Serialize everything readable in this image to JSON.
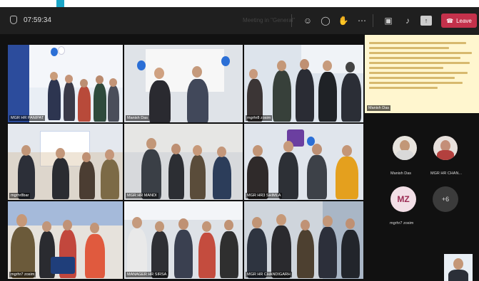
{
  "topbar": {
    "timer": "07:59:34",
    "meeting_title": "Meeting in \"General\"",
    "leave_label": "Leave",
    "icons": [
      "people-icon",
      "chat-icon",
      "reactions-icon",
      "more-icon",
      "camera-icon",
      "mic-icon",
      "share-icon"
    ]
  },
  "tiles": [
    {
      "name": "MGR HR PANIPAT"
    },
    {
      "name": "Manish Das"
    },
    {
      "name": "mgrhr8 zosim"
    },
    {
      "name": "mgrhr8bar"
    },
    {
      "name": "MGR HR MANDI"
    },
    {
      "name": "MGR HR3 SHIMLA"
    },
    {
      "name": "mgrhr7 zosim"
    },
    {
      "name": "MANAGER HR SIRSA"
    },
    {
      "name": "MGR HR CHANDIGARH"
    }
  ],
  "document": {
    "name": "Manish Das"
  },
  "sidebar": {
    "participant1": "Manish Das",
    "participant2": "MGR HR CHAN...",
    "mz_initials": "MZ",
    "mz_name": "mgrhr7 zosim",
    "more_count": "+6"
  },
  "colors": {
    "leave": "#c4314b",
    "topbar": "#1f1f1f",
    "accent": "#1aa6c8"
  }
}
